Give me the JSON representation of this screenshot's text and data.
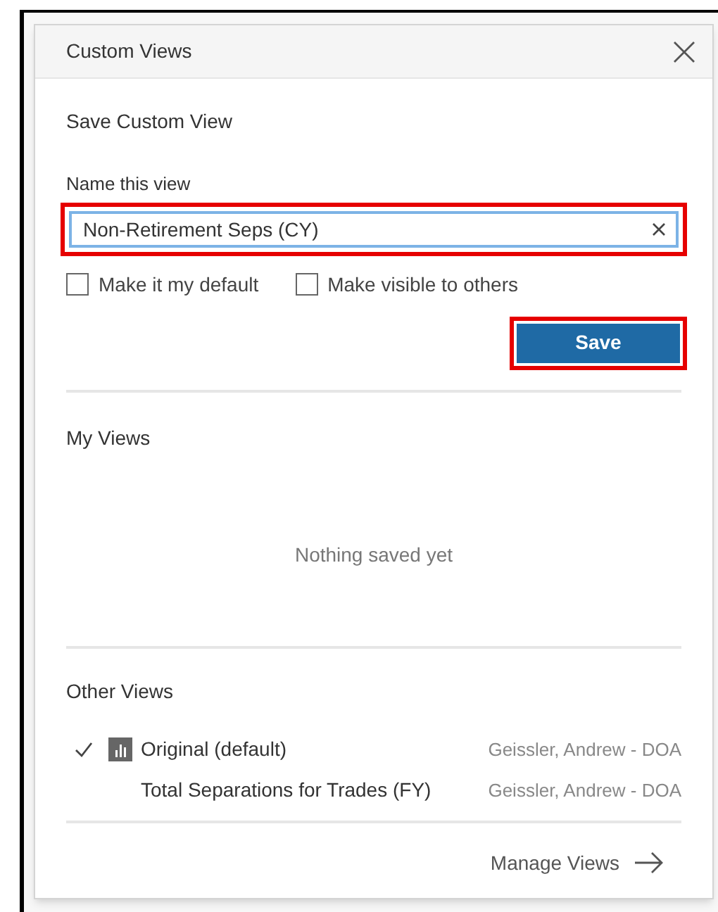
{
  "dialog": {
    "title": "Custom Views"
  },
  "save_section": {
    "heading": "Save Custom View",
    "name_label": "Name this view",
    "name_field": {
      "value": "Non-Retirement Seps (CY)",
      "highlighted": true
    },
    "checkboxes": [
      {
        "label": "Make it my default",
        "checked": false
      },
      {
        "label": "Make visible to others",
        "checked": false
      }
    ],
    "save_button": {
      "label": "Save",
      "highlighted": true
    }
  },
  "my_views": {
    "heading": "My Views",
    "empty_text": "Nothing saved yet"
  },
  "other_views": {
    "heading": "Other Views",
    "items": [
      {
        "name": "Original (default)",
        "owner": "Geissler, Andrew - DOA",
        "selected": true,
        "kind": "original"
      },
      {
        "name": "Total Separations for Trades (FY)",
        "owner": "Geissler, Andrew - DOA",
        "selected": false,
        "kind": "custom"
      }
    ]
  },
  "footer": {
    "link": "Manage Views"
  }
}
